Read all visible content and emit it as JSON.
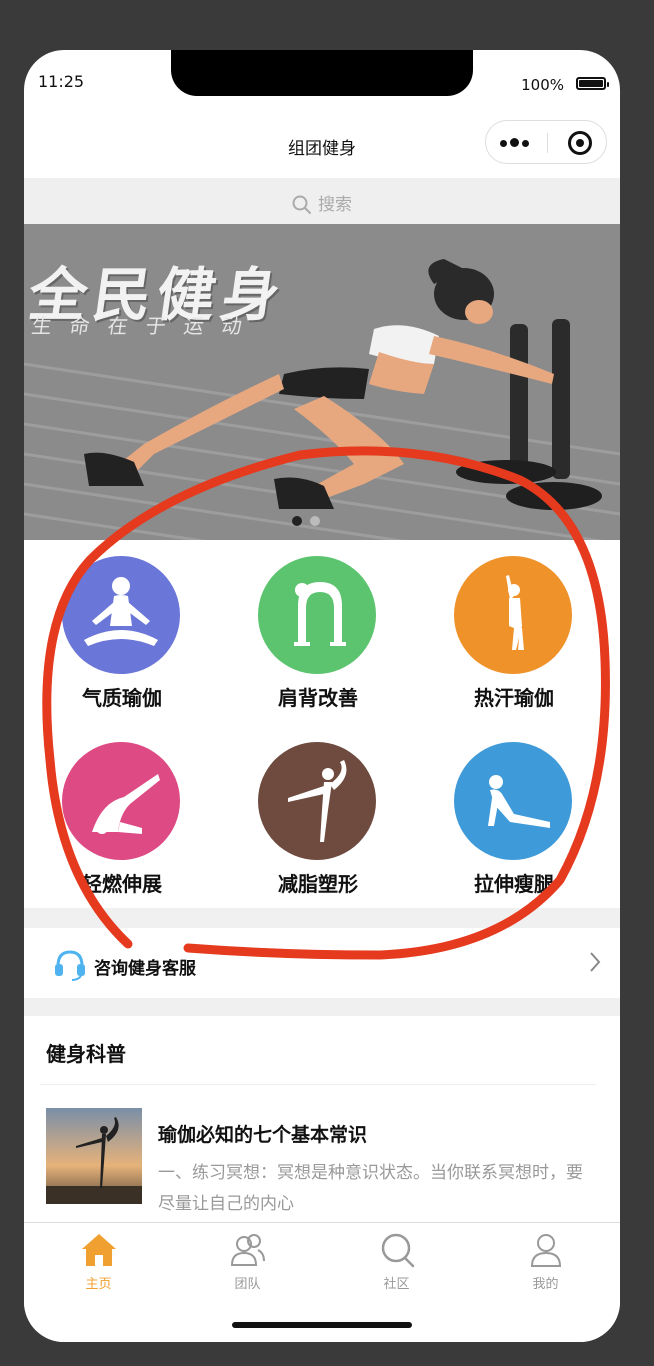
{
  "status_bar": {
    "time": "11:25",
    "battery": "100%"
  },
  "nav": {
    "title": "组团健身"
  },
  "search": {
    "placeholder": "搜索"
  },
  "banner": {
    "title": "全民健身",
    "subtitle": "生命在于运动"
  },
  "categories": [
    {
      "label": "气质瑜伽",
      "color": "#6b77d8",
      "icon": "meditation-pose-icon"
    },
    {
      "label": "肩背改善",
      "color": "#5cc46e",
      "icon": "backbend-pose-icon"
    },
    {
      "label": "热汗瑜伽",
      "color": "#f0922a",
      "icon": "standing-stretch-icon"
    },
    {
      "label": "轻燃伸展",
      "color": "#dd4a84",
      "icon": "plow-pose-icon"
    },
    {
      "label": "减脂塑形",
      "color": "#6e4b3e",
      "icon": "dancer-pose-icon"
    },
    {
      "label": "拉伸瘦腿",
      "color": "#3e9ad8",
      "icon": "cobra-pose-icon"
    }
  ],
  "service": {
    "label": "咨询健身客服",
    "icon": "headset-icon"
  },
  "science": {
    "title": "健身科普",
    "articles": [
      {
        "title": "瑜伽必知的七个基本常识",
        "excerpt": "一、练习冥想：冥想是种意识状态。当你联系冥想时，要尽量让自己的内心"
      }
    ]
  },
  "tabbar": {
    "items": [
      {
        "label": "主页",
        "icon": "home-icon",
        "active": true
      },
      {
        "label": "团队",
        "icon": "team-icon",
        "active": false
      },
      {
        "label": "社区",
        "icon": "community-icon",
        "active": false
      },
      {
        "label": "我的",
        "icon": "profile-icon",
        "active": false
      }
    ],
    "active_color": "#f0a030"
  }
}
